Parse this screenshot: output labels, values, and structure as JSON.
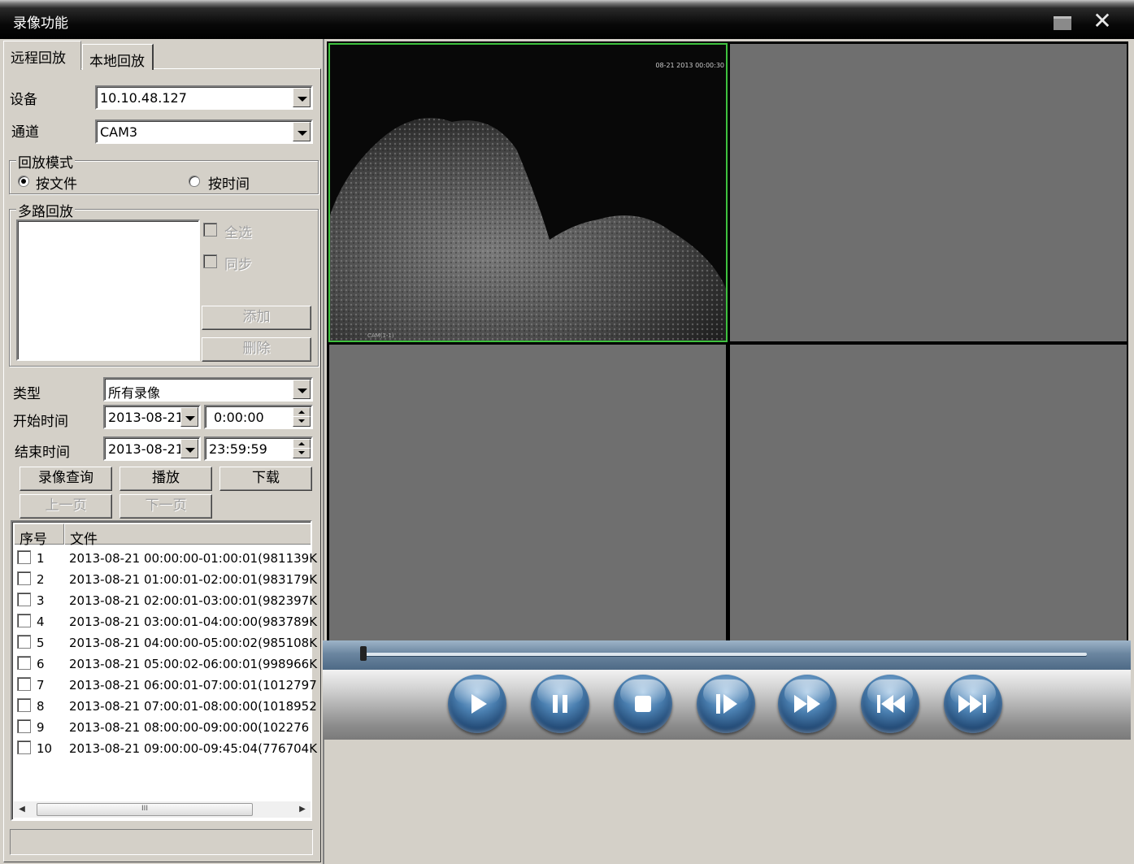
{
  "window": {
    "title": "录像功能"
  },
  "tabs": [
    {
      "label": "远程回放"
    },
    {
      "label": "本地回放"
    }
  ],
  "device": {
    "label": "设备",
    "value": "10.10.48.127"
  },
  "channel": {
    "label": "通道",
    "value": "CAM3"
  },
  "playback_mode": {
    "title": "回放模式",
    "by_file": "按文件",
    "by_time": "按时间",
    "selected": "按文件"
  },
  "multi_playback": {
    "title": "多路回放",
    "select_all": "全选",
    "sync": "同步",
    "add": "添加",
    "delete": "删除"
  },
  "type": {
    "label": "类型",
    "value": "所有录像"
  },
  "start_time": {
    "label": "开始时间",
    "date": "2013-08-21",
    "time": "0:00:00"
  },
  "end_time": {
    "label": "结束时间",
    "date": "2013-08-21",
    "time": "23:59:59"
  },
  "buttons": {
    "query": "录像查询",
    "play": "播放",
    "download": "下载",
    "prev_page": "上一页",
    "next_page": "下一页"
  },
  "file_list": {
    "columns": [
      "序号",
      "文件"
    ],
    "rows": [
      {
        "no": "1",
        "file": "2013-08-21 00:00:00-01:00:01(981139K"
      },
      {
        "no": "2",
        "file": "2013-08-21 01:00:01-02:00:01(983179K"
      },
      {
        "no": "3",
        "file": "2013-08-21 02:00:01-03:00:01(982397K"
      },
      {
        "no": "4",
        "file": "2013-08-21 03:00:01-04:00:00(983789K"
      },
      {
        "no": "5",
        "file": "2013-08-21 04:00:00-05:00:02(985108K"
      },
      {
        "no": "6",
        "file": "2013-08-21 05:00:02-06:00:01(998966K"
      },
      {
        "no": "7",
        "file": "2013-08-21 06:00:01-07:00:01(1012797"
      },
      {
        "no": "8",
        "file": "2013-08-21 07:00:01-08:00:00(1018952"
      },
      {
        "no": "9",
        "file": "2013-08-21 08:00:00-09:00:00(102276"
      },
      {
        "no": "10",
        "file": "2013-08-21 09:00:00-09:45:04(776704K"
      }
    ],
    "scrollbar_grip": "III"
  },
  "video": {
    "osd_time": "08-21 2013 00:00:30",
    "osd_cam": "CAM(1-1)"
  },
  "seek": {
    "position_fraction": 0.0
  },
  "controls": [
    "play-icon",
    "pause-icon",
    "stop-icon",
    "step-frame-icon",
    "fast-forward-icon",
    "skip-back-icon",
    "skip-forward-icon"
  ],
  "colors": {
    "selected_cell_border": "#3ec13e",
    "empty_cell": "#6f6f6f",
    "control_blue": "#4a7fb0"
  }
}
